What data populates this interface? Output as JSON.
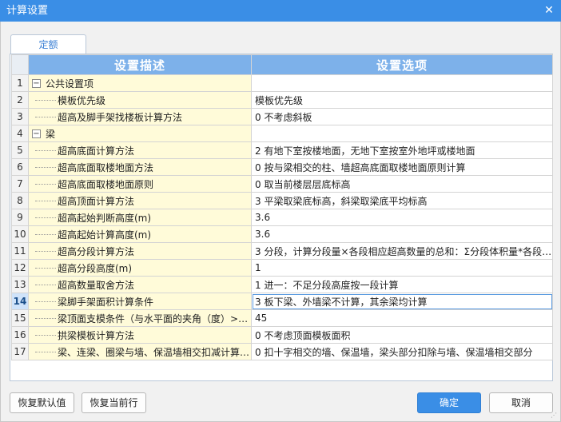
{
  "window": {
    "title": "计算设置"
  },
  "tabs": [
    {
      "label": "定额"
    }
  ],
  "grid": {
    "headers": {
      "desc": "设置描述",
      "opt": "设置选项"
    },
    "rows": [
      {
        "num": "1",
        "group": true,
        "desc": "公共设置项",
        "opt": ""
      },
      {
        "num": "2",
        "desc": "模板优先级",
        "opt": "模板优先级"
      },
      {
        "num": "3",
        "desc": "超高及脚手架找楼板计算方法",
        "opt": "0 不考虑斜板"
      },
      {
        "num": "4",
        "group": true,
        "desc": "梁",
        "opt": ""
      },
      {
        "num": "5",
        "desc": "超高底面计算方法",
        "opt": "2 有地下室按楼地面，无地下室按室外地坪或楼地面"
      },
      {
        "num": "6",
        "desc": "超高底面取楼地面方法",
        "opt": "0 按与梁相交的柱、墙超高底面取楼地面原则计算"
      },
      {
        "num": "7",
        "desc": "超高底面取楼地面原则",
        "opt": "0 取当前楼层层底标高"
      },
      {
        "num": "8",
        "desc": "超高顶面计算方法",
        "opt": "3 平梁取梁底标高，斜梁取梁底平均标高"
      },
      {
        "num": "9",
        "desc": "超高起始判断高度(m)",
        "opt": "3.6"
      },
      {
        "num": "10",
        "desc": "超高起始计算高度(m)",
        "opt": "3.6"
      },
      {
        "num": "11",
        "desc": "超高分段计算方法",
        "opt": "3 分段，计算分段量×各段相应超高数量的总和：Σ分段体积量*各段…"
      },
      {
        "num": "12",
        "desc": "超高分段高度(m)",
        "opt": "1"
      },
      {
        "num": "13",
        "desc": "超高数量取舍方法",
        "opt": "1 进一：不足分段高度按一段计算"
      },
      {
        "num": "14",
        "desc": "梁脚手架面积计算条件",
        "opt": "3 板下梁、外墙梁不计算，其余梁均计算",
        "selected": true
      },
      {
        "num": "15",
        "desc": "梁顶面支模条件（与水平面的夹角（度）>=）",
        "opt": "45"
      },
      {
        "num": "16",
        "desc": "拱梁模板计算方法",
        "opt": "0 不考虑顶面模板面积"
      },
      {
        "num": "17",
        "desc": "梁、连梁、圈梁与墙、保温墙相交扣减计算…",
        "opt": "0 扣十字相交的墙、保温墙，梁头部分扣除与墙、保温墙相交部分"
      }
    ]
  },
  "buttons": {
    "restore_default": "恢复默认值",
    "restore_row": "恢复当前行",
    "ok": "确定",
    "cancel": "取消"
  }
}
